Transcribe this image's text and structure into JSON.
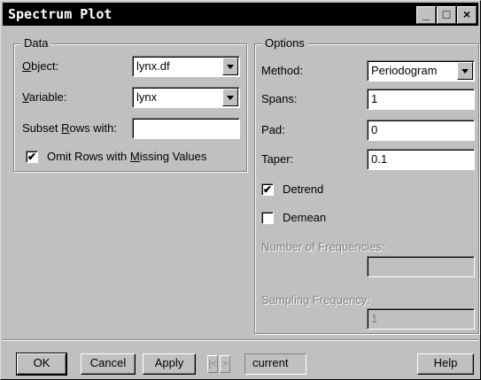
{
  "window": {
    "title": "Spectrum Plot",
    "minimize_glyph": "_",
    "maximize_glyph": "□",
    "close_glyph": "×"
  },
  "data_group": {
    "label": "Data",
    "object": {
      "label_u": "O",
      "label_rest": "bject:",
      "value": "lynx.df"
    },
    "variable": {
      "label_u": "V",
      "label_rest": "ariable:",
      "value": "lynx"
    },
    "subset": {
      "label_pre": "Subset ",
      "label_u": "R",
      "label_rest": "ows with:",
      "value": ""
    },
    "omit_missing": {
      "checked": true,
      "label_pre": "Omit Rows with ",
      "label_u": "M",
      "label_rest": "issing Values"
    }
  },
  "options_group": {
    "label": "Options",
    "method": {
      "label": "Method:",
      "value": "Periodogram"
    },
    "spans": {
      "label": "Spans:",
      "value": "1"
    },
    "pad": {
      "label": "Pad:",
      "value": "0"
    },
    "taper": {
      "label": "Taper:",
      "value": "0.1"
    },
    "detrend": {
      "label": "Detrend",
      "checked": true
    },
    "demean": {
      "label": "Demean",
      "checked": false
    },
    "num_freq": {
      "label": "Number of Frequencies:",
      "value": ""
    },
    "sampling_freq": {
      "label": "Sampling Frequency:",
      "value": "1"
    }
  },
  "footer": {
    "ok": "OK",
    "cancel": "Cancel",
    "apply": "Apply",
    "prev_glyph": "|<",
    "next_glyph": ">",
    "current": "current",
    "help": "Help"
  },
  "check_glyph": "✔"
}
